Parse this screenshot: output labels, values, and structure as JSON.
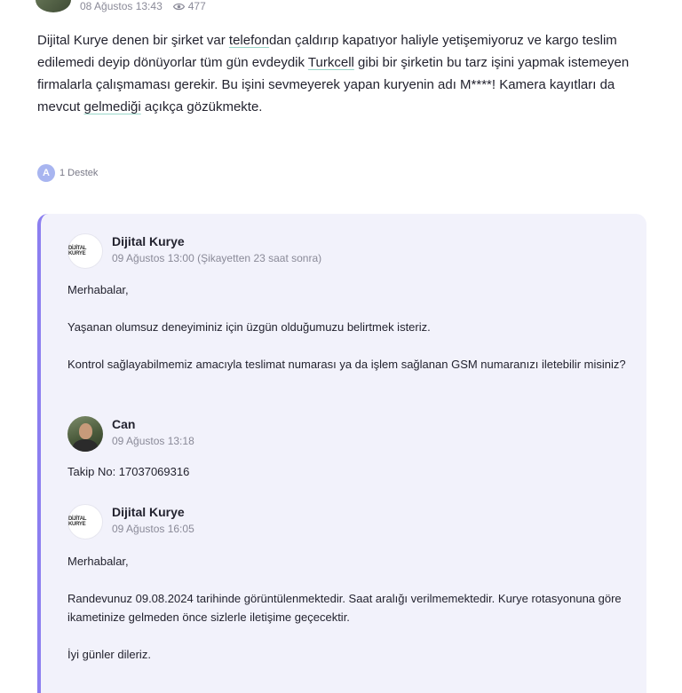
{
  "complaint": {
    "date": "08 Ağustos 13:43",
    "views": "477",
    "text_parts": {
      "p1": "Dijital Kurye denen bir şirket var ",
      "link1": "telefon",
      "p2": "dan çaldırıp kapatıyor haliyle yetişemiyoruz ve kargo teslim edilemedi deyip dönüyorlar tüm gün evdeydik ",
      "link2": "Turkcell",
      "p3": " gibi bir şirketin bu tarz işini yapmak istemeyen firmalarla çalışmaması gerekir. Bu işini sevmeyerek yapan kuryenin adı M****! Kamera kayıtları da mevcut ",
      "link3": "gelmediği",
      "p4": " açıkça gözükmekte."
    }
  },
  "support": {
    "badge": "A",
    "label": "1 Destek"
  },
  "brand_logo_text": "DİJİTAL KURYE",
  "thread": [
    {
      "author": "Dijital Kurye",
      "date": "09 Ağustos 13:00 (Şikayetten 23 saat sonra)",
      "paragraphs": [
        "Merhabalar,",
        "Yaşanan olumsuz deneyiminiz için üzgün olduğumuzu belirtmek isteriz.",
        "Kontrol sağlayabilmemiz amacıyla teslimat numarası ya da işlem sağlanan GSM numaranızı iletebilir misiniz?"
      ]
    },
    {
      "author": "Can",
      "date": "09 Ağustos 13:18",
      "paragraphs": [
        "Takip No: 17037069316"
      ]
    },
    {
      "author": "Dijital Kurye",
      "date": "09 Ağustos 16:05",
      "paragraphs": [
        "Merhabalar,",
        "Randevunuz 09.08.2024 tarihinde görüntülenmektedir. Saat aralığı verilmemektedir. Kurye rotasyonuna göre ikametinize gelmeden önce sizlerle iletişime geçecektir.",
        "İyi günler dileriz."
      ]
    }
  ],
  "icons": {
    "views": "eye-icon",
    "brand": "dijital-kurye-logo",
    "user": "user-avatar"
  },
  "colors": {
    "accent": "#8c7ff0",
    "thread_bg": "#f2f2fb",
    "link_underline": "#9ad7c9",
    "badge": "#a8b5f0"
  }
}
